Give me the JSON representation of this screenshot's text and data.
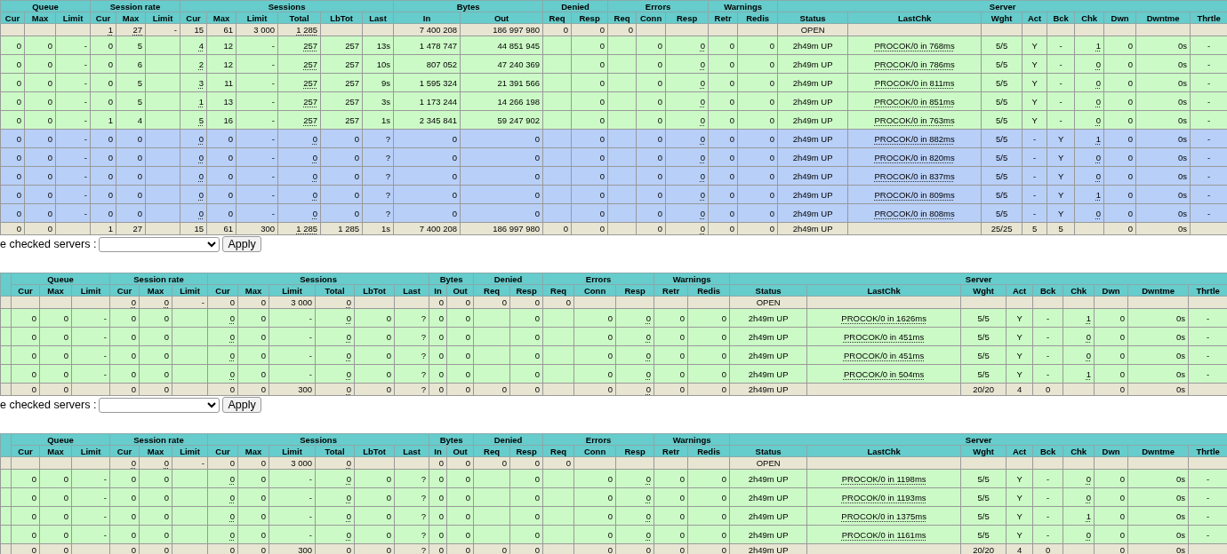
{
  "tables": [
    {
      "leading_column": false,
      "groups": [
        {
          "label": "Queue",
          "kind": "stats",
          "columns": [
            "Cur",
            "Max",
            "Limit"
          ]
        },
        {
          "label": "Session rate",
          "kind": "stats",
          "columns": [
            "Cur",
            "Max",
            "Limit"
          ]
        },
        {
          "label": "Sessions",
          "kind": "stats",
          "columns": [
            "Cur",
            "Max",
            "Limit",
            "Total",
            "LbTot",
            "Last"
          ]
        },
        {
          "label": "Bytes",
          "kind": "stats",
          "columns": [
            "In",
            "Out"
          ]
        },
        {
          "label": "Denied",
          "kind": "stats",
          "columns": [
            "Req",
            "Resp"
          ]
        },
        {
          "label": "Errors",
          "kind": "stats",
          "columns": [
            "Req",
            "Conn",
            "Resp"
          ]
        },
        {
          "label": "Warnings",
          "kind": "stats",
          "columns": [
            "Retr",
            "Redis"
          ]
        },
        {
          "label": "Server",
          "kind": "server",
          "columns": [
            "Status",
            "LastChk",
            "Wght",
            "Act",
            "Bck",
            "Chk",
            "Dwn",
            "Dwntme",
            "Thrtle"
          ]
        }
      ],
      "rows": [
        {
          "kind": "frontend",
          "cells": [
            null,
            null,
            null,
            {
              "text": "1",
              "dotted": true
            },
            {
              "text": "27",
              "dotted": true
            },
            "-",
            "15",
            "61",
            "3 000",
            {
              "text": "1 285",
              "dotted": true
            },
            null,
            null,
            "7 400 208",
            "186 997 980",
            "0",
            "0",
            "0",
            null,
            null,
            null,
            null,
            "OPEN",
            null,
            null,
            null,
            null,
            null,
            null,
            null,
            null
          ]
        },
        {
          "kind": "active",
          "cells": [
            "0",
            "0",
            "-",
            "0",
            "5",
            null,
            {
              "text": "4",
              "dotted": true
            },
            "12",
            "-",
            {
              "text": "257",
              "dotted": true
            },
            "257",
            "13s",
            "1 478 747",
            "44 851 945",
            null,
            "0",
            null,
            "0",
            {
              "text": "0",
              "dotted": true
            },
            "0",
            "0",
            "2h49m UP",
            {
              "text": "PROCOK/0 in 768ms",
              "dotted": true
            },
            "5/5",
            "Y",
            "-",
            {
              "text": "1",
              "dotted": true
            },
            "0",
            "0s",
            "-"
          ]
        },
        {
          "kind": "active",
          "cells": [
            "0",
            "0",
            "-",
            "0",
            "6",
            null,
            {
              "text": "2",
              "dotted": true
            },
            "12",
            "-",
            {
              "text": "257",
              "dotted": true
            },
            "257",
            "10s",
            "807 052",
            "47 240 369",
            null,
            "0",
            null,
            "0",
            {
              "text": "0",
              "dotted": true
            },
            "0",
            "0",
            "2h49m UP",
            {
              "text": "PROCOK/0 in 786ms",
              "dotted": true
            },
            "5/5",
            "Y",
            "-",
            {
              "text": "0",
              "dotted": true
            },
            "0",
            "0s",
            "-"
          ]
        },
        {
          "kind": "active",
          "cells": [
            "0",
            "0",
            "-",
            "0",
            "5",
            null,
            {
              "text": "3",
              "dotted": true
            },
            "11",
            "-",
            {
              "text": "257",
              "dotted": true
            },
            "257",
            "9s",
            "1 595 324",
            "21 391 566",
            null,
            "0",
            null,
            "0",
            {
              "text": "0",
              "dotted": true
            },
            "0",
            "0",
            "2h49m UP",
            {
              "text": "PROCOK/0 in 811ms",
              "dotted": true
            },
            "5/5",
            "Y",
            "-",
            {
              "text": "0",
              "dotted": true
            },
            "0",
            "0s",
            "-"
          ]
        },
        {
          "kind": "active",
          "cells": [
            "0",
            "0",
            "-",
            "0",
            "5",
            null,
            {
              "text": "1",
              "dotted": true
            },
            "13",
            "-",
            {
              "text": "257",
              "dotted": true
            },
            "257",
            "3s",
            "1 173 244",
            "14 266 198",
            null,
            "0",
            null,
            "0",
            {
              "text": "0",
              "dotted": true
            },
            "0",
            "0",
            "2h49m UP",
            {
              "text": "PROCOK/0 in 851ms",
              "dotted": true
            },
            "5/5",
            "Y",
            "-",
            {
              "text": "0",
              "dotted": true
            },
            "0",
            "0s",
            "-"
          ]
        },
        {
          "kind": "active",
          "cells": [
            "0",
            "0",
            "-",
            "1",
            "4",
            null,
            {
              "text": "5",
              "dotted": true
            },
            "16",
            "-",
            {
              "text": "257",
              "dotted": true
            },
            "257",
            "1s",
            "2 345 841",
            "59 247 902",
            null,
            "0",
            null,
            "0",
            {
              "text": "0",
              "dotted": true
            },
            "0",
            "0",
            "2h49m UP",
            {
              "text": "PROCOK/0 in 763ms",
              "dotted": true
            },
            "5/5",
            "Y",
            "-",
            {
              "text": "0",
              "dotted": true
            },
            "0",
            "0s",
            "-"
          ]
        },
        {
          "kind": "backup",
          "cells": [
            "0",
            "0",
            "-",
            "0",
            "0",
            null,
            {
              "text": "0",
              "dotted": true
            },
            "0",
            "-",
            {
              "text": "0",
              "dotted": true
            },
            "0",
            "?",
            "0",
            "0",
            null,
            "0",
            null,
            "0",
            {
              "text": "0",
              "dotted": true
            },
            "0",
            "0",
            "2h49m UP",
            {
              "text": "PROCOK/0 in 882ms",
              "dotted": true
            },
            "5/5",
            "-",
            "Y",
            {
              "text": "1",
              "dotted": true
            },
            "0",
            "0s",
            "-"
          ]
        },
        {
          "kind": "backup",
          "cells": [
            "0",
            "0",
            "-",
            "0",
            "0",
            null,
            {
              "text": "0",
              "dotted": true
            },
            "0",
            "-",
            {
              "text": "0",
              "dotted": true
            },
            "0",
            "?",
            "0",
            "0",
            null,
            "0",
            null,
            "0",
            {
              "text": "0",
              "dotted": true
            },
            "0",
            "0",
            "2h49m UP",
            {
              "text": "PROCOK/0 in 820ms",
              "dotted": true
            },
            "5/5",
            "-",
            "Y",
            {
              "text": "0",
              "dotted": true
            },
            "0",
            "0s",
            "-"
          ]
        },
        {
          "kind": "backup",
          "cells": [
            "0",
            "0",
            "-",
            "0",
            "0",
            null,
            {
              "text": "0",
              "dotted": true
            },
            "0",
            "-",
            {
              "text": "0",
              "dotted": true
            },
            "0",
            "?",
            "0",
            "0",
            null,
            "0",
            null,
            "0",
            {
              "text": "0",
              "dotted": true
            },
            "0",
            "0",
            "2h49m UP",
            {
              "text": "PROCOK/0 in 837ms",
              "dotted": true
            },
            "5/5",
            "-",
            "Y",
            {
              "text": "0",
              "dotted": true
            },
            "0",
            "0s",
            "-"
          ]
        },
        {
          "kind": "backup",
          "cells": [
            "0",
            "0",
            "-",
            "0",
            "0",
            null,
            {
              "text": "0",
              "dotted": true
            },
            "0",
            "-",
            {
              "text": "0",
              "dotted": true
            },
            "0",
            "?",
            "0",
            "0",
            null,
            "0",
            null,
            "0",
            {
              "text": "0",
              "dotted": true
            },
            "0",
            "0",
            "2h49m UP",
            {
              "text": "PROCOK/0 in 809ms",
              "dotted": true
            },
            "5/5",
            "-",
            "Y",
            {
              "text": "1",
              "dotted": true
            },
            "0",
            "0s",
            "-"
          ]
        },
        {
          "kind": "backup",
          "cells": [
            "0",
            "0",
            "-",
            "0",
            "0",
            null,
            {
              "text": "0",
              "dotted": true
            },
            "0",
            "-",
            {
              "text": "0",
              "dotted": true
            },
            "0",
            "?",
            "0",
            "0",
            null,
            "0",
            null,
            "0",
            {
              "text": "0",
              "dotted": true
            },
            "0",
            "0",
            "2h49m UP",
            {
              "text": "PROCOK/0 in 808ms",
              "dotted": true
            },
            "5/5",
            "-",
            "Y",
            {
              "text": "0",
              "dotted": true
            },
            "0",
            "0s",
            "-"
          ]
        },
        {
          "kind": "backend",
          "cells": [
            "0",
            "0",
            null,
            "1",
            "27",
            null,
            "15",
            "61",
            "300",
            {
              "text": "1 285",
              "dotted": true
            },
            "1 285",
            "1s",
            "7 400 208",
            "186 997 980",
            "0",
            "0",
            null,
            "0",
            {
              "text": "0",
              "dotted": true
            },
            "0",
            "0",
            "2h49m UP",
            null,
            "25/25",
            "5",
            "5",
            null,
            "0",
            "0s",
            null
          ]
        }
      ],
      "action_form": {
        "label": "e checked servers :",
        "button": "Apply"
      }
    },
    {
      "leading_column": true,
      "groups": [
        {
          "label": "Queue",
          "kind": "stats",
          "columns": [
            "Cur",
            "Max",
            "Limit"
          ]
        },
        {
          "label": "Session rate",
          "kind": "stats",
          "columns": [
            "Cur",
            "Max",
            "Limit"
          ]
        },
        {
          "label": "Sessions",
          "kind": "stats",
          "columns": [
            "Cur",
            "Max",
            "Limit",
            "Total",
            "LbTot",
            "Last"
          ]
        },
        {
          "label": "Bytes",
          "kind": "stats",
          "columns": [
            "In",
            "Out"
          ]
        },
        {
          "label": "Denied",
          "kind": "stats",
          "columns": [
            "Req",
            "Resp"
          ]
        },
        {
          "label": "Errors",
          "kind": "stats",
          "columns": [
            "Req",
            "Conn",
            "Resp"
          ]
        },
        {
          "label": "Warnings",
          "kind": "stats",
          "columns": [
            "Retr",
            "Redis"
          ]
        },
        {
          "label": "Server",
          "kind": "server",
          "columns": [
            "Status",
            "LastChk",
            "Wght",
            "Act",
            "Bck",
            "Chk",
            "Dwn",
            "Dwntme",
            "Thrtle"
          ]
        }
      ],
      "rows": [
        {
          "kind": "frontend",
          "cells": [
            null,
            null,
            null,
            {
              "text": "0",
              "dotted": true
            },
            {
              "text": "0",
              "dotted": true
            },
            "-",
            "0",
            "0",
            "3 000",
            {
              "text": "0",
              "dotted": true
            },
            null,
            null,
            "0",
            "0",
            "0",
            "0",
            "0",
            null,
            null,
            null,
            null,
            "OPEN",
            null,
            null,
            null,
            null,
            null,
            null,
            null,
            null
          ]
        },
        {
          "kind": "active",
          "cells": [
            "0",
            "0",
            "-",
            "0",
            "0",
            null,
            {
              "text": "0",
              "dotted": true
            },
            "0",
            "-",
            {
              "text": "0",
              "dotted": true
            },
            "0",
            "?",
            "0",
            "0",
            null,
            "0",
            null,
            "0",
            {
              "text": "0",
              "dotted": true
            },
            "0",
            "0",
            "2h49m UP",
            {
              "text": "PROCOK/0 in 1626ms",
              "dotted": true
            },
            "5/5",
            "Y",
            "-",
            {
              "text": "1",
              "dotted": true
            },
            "0",
            "0s",
            "-"
          ]
        },
        {
          "kind": "active",
          "cells": [
            "0",
            "0",
            "-",
            "0",
            "0",
            null,
            {
              "text": "0",
              "dotted": true
            },
            "0",
            "-",
            {
              "text": "0",
              "dotted": true
            },
            "0",
            "?",
            "0",
            "0",
            null,
            "0",
            null,
            "0",
            {
              "text": "0",
              "dotted": true
            },
            "0",
            "0",
            "2h49m UP",
            {
              "text": "PROCOK/0 in 451ms",
              "dotted": true
            },
            "5/5",
            "Y",
            "-",
            {
              "text": "0",
              "dotted": true
            },
            "0",
            "0s",
            "-"
          ]
        },
        {
          "kind": "active",
          "cells": [
            "0",
            "0",
            "-",
            "0",
            "0",
            null,
            {
              "text": "0",
              "dotted": true
            },
            "0",
            "-",
            {
              "text": "0",
              "dotted": true
            },
            "0",
            "?",
            "0",
            "0",
            null,
            "0",
            null,
            "0",
            {
              "text": "0",
              "dotted": true
            },
            "0",
            "0",
            "2h49m UP",
            {
              "text": "PROCOK/0 in 451ms",
              "dotted": true
            },
            "5/5",
            "Y",
            "-",
            {
              "text": "0",
              "dotted": true
            },
            "0",
            "0s",
            "-"
          ]
        },
        {
          "kind": "active",
          "cells": [
            "0",
            "0",
            "-",
            "0",
            "0",
            null,
            {
              "text": "0",
              "dotted": true
            },
            "0",
            "-",
            {
              "text": "0",
              "dotted": true
            },
            "0",
            "?",
            "0",
            "0",
            null,
            "0",
            null,
            "0",
            {
              "text": "0",
              "dotted": true
            },
            "0",
            "0",
            "2h49m UP",
            {
              "text": "PROCOK/0 in 504ms",
              "dotted": true
            },
            "5/5",
            "Y",
            "-",
            {
              "text": "1",
              "dotted": true
            },
            "0",
            "0s",
            "-"
          ]
        },
        {
          "kind": "backend",
          "cells": [
            "0",
            "0",
            null,
            "0",
            "0",
            null,
            "0",
            "0",
            "300",
            {
              "text": "0",
              "dotted": true
            },
            "0",
            "?",
            "0",
            "0",
            "0",
            "0",
            null,
            "0",
            {
              "text": "0",
              "dotted": true
            },
            "0",
            "0",
            "2h49m UP",
            null,
            "20/20",
            "4",
            "0",
            null,
            "0",
            "0s",
            null
          ]
        }
      ],
      "action_form": {
        "label": "e checked servers :",
        "button": "Apply"
      }
    },
    {
      "leading_column": true,
      "groups": [
        {
          "label": "Queue",
          "kind": "stats",
          "columns": [
            "Cur",
            "Max",
            "Limit"
          ]
        },
        {
          "label": "Session rate",
          "kind": "stats",
          "columns": [
            "Cur",
            "Max",
            "Limit"
          ]
        },
        {
          "label": "Sessions",
          "kind": "stats",
          "columns": [
            "Cur",
            "Max",
            "Limit",
            "Total",
            "LbTot",
            "Last"
          ]
        },
        {
          "label": "Bytes",
          "kind": "stats",
          "columns": [
            "In",
            "Out"
          ]
        },
        {
          "label": "Denied",
          "kind": "stats",
          "columns": [
            "Req",
            "Resp"
          ]
        },
        {
          "label": "Errors",
          "kind": "stats",
          "columns": [
            "Req",
            "Conn",
            "Resp"
          ]
        },
        {
          "label": "Warnings",
          "kind": "stats",
          "columns": [
            "Retr",
            "Redis"
          ]
        },
        {
          "label": "Server",
          "kind": "server",
          "columns": [
            "Status",
            "LastChk",
            "Wght",
            "Act",
            "Bck",
            "Chk",
            "Dwn",
            "Dwntme",
            "Thrtle"
          ]
        }
      ],
      "rows": [
        {
          "kind": "frontend",
          "cells": [
            null,
            null,
            null,
            {
              "text": "0",
              "dotted": true
            },
            {
              "text": "0",
              "dotted": true
            },
            "-",
            "0",
            "0",
            "3 000",
            {
              "text": "0",
              "dotted": true
            },
            null,
            null,
            "0",
            "0",
            "0",
            "0",
            "0",
            null,
            null,
            null,
            null,
            "OPEN",
            null,
            null,
            null,
            null,
            null,
            null,
            null,
            null
          ]
        },
        {
          "kind": "active",
          "cells": [
            "0",
            "0",
            "-",
            "0",
            "0",
            null,
            {
              "text": "0",
              "dotted": true
            },
            "0",
            "-",
            {
              "text": "0",
              "dotted": true
            },
            "0",
            "?",
            "0",
            "0",
            null,
            "0",
            null,
            "0",
            {
              "text": "0",
              "dotted": true
            },
            "0",
            "0",
            "2h49m UP",
            {
              "text": "PROCOK/0 in 1198ms",
              "dotted": true
            },
            "5/5",
            "Y",
            "-",
            {
              "text": "0",
              "dotted": true
            },
            "0",
            "0s",
            "-"
          ]
        },
        {
          "kind": "active",
          "cells": [
            "0",
            "0",
            "-",
            "0",
            "0",
            null,
            {
              "text": "0",
              "dotted": true
            },
            "0",
            "-",
            {
              "text": "0",
              "dotted": true
            },
            "0",
            "?",
            "0",
            "0",
            null,
            "0",
            null,
            "0",
            {
              "text": "0",
              "dotted": true
            },
            "0",
            "0",
            "2h49m UP",
            {
              "text": "PROCOK/0 in 1193ms",
              "dotted": true
            },
            "5/5",
            "Y",
            "-",
            {
              "text": "0",
              "dotted": true
            },
            "0",
            "0s",
            "-"
          ]
        },
        {
          "kind": "active",
          "cells": [
            "0",
            "0",
            "-",
            "0",
            "0",
            null,
            {
              "text": "0",
              "dotted": true
            },
            "0",
            "-",
            {
              "text": "0",
              "dotted": true
            },
            "0",
            "?",
            "0",
            "0",
            null,
            "0",
            null,
            "0",
            {
              "text": "0",
              "dotted": true
            },
            "0",
            "0",
            "2h49m UP",
            {
              "text": "PROCOK/0 in 1375ms",
              "dotted": true
            },
            "5/5",
            "Y",
            "-",
            {
              "text": "1",
              "dotted": true
            },
            "0",
            "0s",
            "-"
          ]
        },
        {
          "kind": "active",
          "cells": [
            "0",
            "0",
            "-",
            "0",
            "0",
            null,
            {
              "text": "0",
              "dotted": true
            },
            "0",
            "-",
            {
              "text": "0",
              "dotted": true
            },
            "0",
            "?",
            "0",
            "0",
            null,
            "0",
            null,
            "0",
            {
              "text": "0",
              "dotted": true
            },
            "0",
            "0",
            "2h49m UP",
            {
              "text": "PROCOK/0 in 1161ms",
              "dotted": true
            },
            "5/5",
            "Y",
            "-",
            {
              "text": "0",
              "dotted": true
            },
            "0",
            "0s",
            "-"
          ]
        },
        {
          "kind": "backend",
          "cells": [
            "0",
            "0",
            null,
            "0",
            "0",
            null,
            "0",
            "0",
            "300",
            {
              "text": "0",
              "dotted": true
            },
            "0",
            "?",
            "0",
            "0",
            "0",
            "0",
            null,
            "0",
            {
              "text": "0",
              "dotted": true
            },
            "0",
            "0",
            "2h49m UP",
            null,
            "20/20",
            "4",
            "0",
            null,
            "0",
            "0s",
            null
          ]
        }
      ]
    }
  ]
}
